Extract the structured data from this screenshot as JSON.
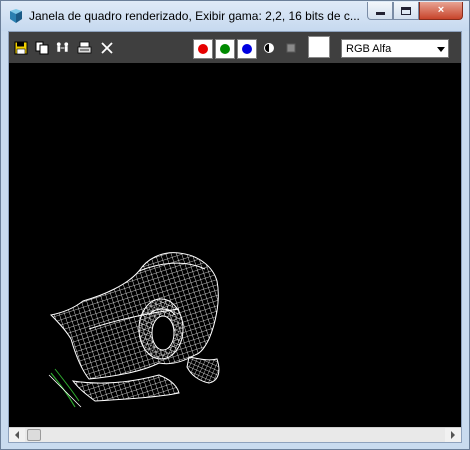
{
  "window": {
    "title": "Janela de quadro renderizado, Exibir gama: 2,2, 16 bits de c...",
    "icon": "3ds-max-app-icon",
    "caption_buttons": {
      "minimize": "minimize-icon",
      "maximize": "maximize-icon",
      "close": "×"
    }
  },
  "toolbar": {
    "icons": [
      "save-icon",
      "copy-icon",
      "clone-icon",
      "print-icon",
      "clear-icon"
    ],
    "channels": [
      {
        "name": "red-channel",
        "color": "#e60000"
      },
      {
        "name": "green-channel",
        "color": "#008a00"
      },
      {
        "name": "blue-channel",
        "color": "#0000e0"
      }
    ],
    "display_icons": [
      "mono-channel-icon",
      "alpha-display-icon"
    ],
    "swatch_color": "#ffffff",
    "channel_select": {
      "value": "RGB Alfa"
    }
  },
  "viewport": {
    "background": "#000000",
    "render": "white-wireframe-mesh"
  },
  "colors": {
    "toolbar_bg": "#3f3f3f",
    "window_frame": "#c9dbef"
  }
}
